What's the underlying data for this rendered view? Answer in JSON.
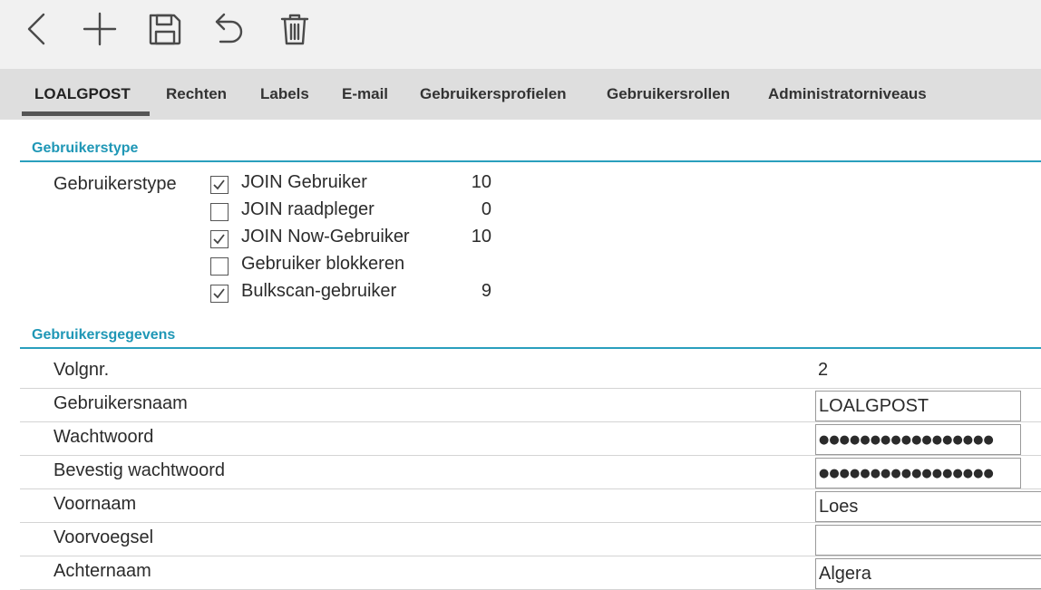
{
  "toolbar": {
    "icons": [
      "back-icon",
      "add-icon",
      "save-icon",
      "undo-icon",
      "trash-icon"
    ]
  },
  "tabs": [
    {
      "label": "LOALGPOST",
      "active": true
    },
    {
      "label": "Rechten"
    },
    {
      "label": "Labels"
    },
    {
      "label": "E-mail"
    },
    {
      "label": "Gebruikersprofielen"
    },
    {
      "label": "Gebruikersrollen"
    },
    {
      "label": "Administratorniveaus"
    }
  ],
  "section_type": {
    "title": "Gebruikerstype",
    "label": "Gebruikerstype",
    "options": [
      {
        "label": "JOIN Gebruiker",
        "checked": true,
        "count": "10"
      },
      {
        "label": "JOIN raadpleger",
        "checked": false,
        "count": "0"
      },
      {
        "label": "JOIN Now-Gebruiker",
        "checked": true,
        "count": "10"
      },
      {
        "label": "Gebruiker blokkeren",
        "checked": false,
        "count": ""
      },
      {
        "label": "Bulkscan-gebruiker",
        "checked": true,
        "count": "9"
      }
    ]
  },
  "section_data": {
    "title": "Gebruikersgegevens",
    "fields": {
      "volgnr": {
        "label": "Volgnr.",
        "value": "2"
      },
      "gebruikersnaam": {
        "label": "Gebruikersnaam",
        "value": "LOALGPOST"
      },
      "wachtwoord": {
        "label": "Wachtwoord",
        "value": "●●●●●●●●●●●●●●●●●"
      },
      "bevestig": {
        "label": "Bevestig wachtwoord",
        "value": "●●●●●●●●●●●●●●●●●"
      },
      "voornaam": {
        "label": "Voornaam",
        "value": "Loes"
      },
      "voorvoegsel": {
        "label": "Voorvoegsel",
        "value": ""
      },
      "achternaam": {
        "label": "Achternaam",
        "value": "Algera"
      }
    }
  },
  "colors": {
    "accent": "#1f97b6",
    "toolbar_bg": "#f1f1f1",
    "tabbar_bg": "#dedede"
  }
}
